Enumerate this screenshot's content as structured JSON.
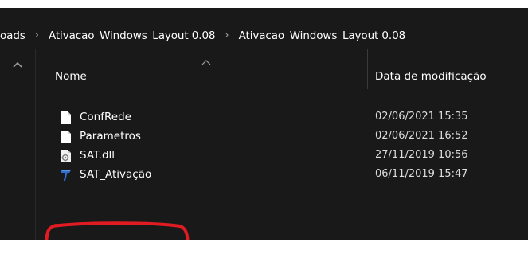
{
  "breadcrumb": {
    "items": [
      {
        "label": "oads"
      },
      {
        "label": "Ativacao_Windows_Layout 0.08"
      },
      {
        "label": "Ativacao_Windows_Layout 0.08"
      }
    ],
    "separator": "›"
  },
  "columns": {
    "name": "Nome",
    "date_modified": "Data de modificação",
    "sort_column": "name",
    "sort_direction": "ascending"
  },
  "files": [
    {
      "name": "ConfRede",
      "date": "02/06/2021 15:35",
      "icon": "generic-file-icon"
    },
    {
      "name": "Parametros",
      "date": "02/06/2021 16:52",
      "icon": "generic-file-icon"
    },
    {
      "name": "SAT.dll",
      "date": "27/11/2019 10:56",
      "icon": "dll-file-icon"
    },
    {
      "name": "SAT_Ativação",
      "date": "06/11/2019 15:47",
      "icon": "app-executable-icon",
      "highlighted": true
    }
  ],
  "colors": {
    "background": "#191919",
    "text": "#ffffff",
    "highlight_circle": "#e11b22",
    "app_icon": "#2f6fd0"
  }
}
